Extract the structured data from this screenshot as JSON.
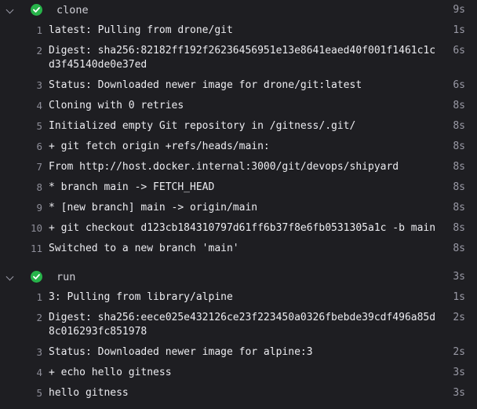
{
  "colors": {
    "background": "#1e1e22",
    "success": "#27b34a",
    "text": "#ececf0",
    "muted": "#9a9aa6"
  },
  "steps": [
    {
      "name": "clone",
      "duration": "9s",
      "status_icon": "success-check-icon",
      "lines": [
        {
          "num": "1",
          "text": "latest: Pulling from drone/git",
          "time": "1s"
        },
        {
          "num": "2",
          "text": "Digest: sha256:82182ff192f26236456951e13e8641eaed40f001f1461c1cd3f45140de0e37ed",
          "time": "6s"
        },
        {
          "num": "3",
          "text": "Status: Downloaded newer image for drone/git:latest",
          "time": "6s"
        },
        {
          "num": "4",
          "text": "Cloning with 0 retries",
          "time": "8s"
        },
        {
          "num": "5",
          "text": "Initialized empty Git repository in /gitness/.git/",
          "time": "8s"
        },
        {
          "num": "6",
          "text": "+ git fetch origin +refs/heads/main:",
          "time": "8s"
        },
        {
          "num": "7",
          "text": "From http://host.docker.internal:3000/git/devops/shipyard",
          "time": "8s"
        },
        {
          "num": "8",
          "text": "* branch main -> FETCH_HEAD",
          "time": "8s"
        },
        {
          "num": "9",
          "text": "* [new branch] main -> origin/main",
          "time": "8s"
        },
        {
          "num": "10",
          "text": "+ git checkout d123cb184310797d61ff6b37f8e6fb0531305a1c -b main",
          "time": "8s"
        },
        {
          "num": "11",
          "text": "Switched to a new branch 'main'",
          "time": "8s"
        }
      ]
    },
    {
      "name": "run",
      "duration": "3s",
      "status_icon": "success-check-icon",
      "lines": [
        {
          "num": "1",
          "text": "3: Pulling from library/alpine",
          "time": "1s"
        },
        {
          "num": "2",
          "text": "Digest: sha256:eece025e432126ce23f223450a0326fbebde39cdf496a85d8c016293fc851978",
          "time": "2s"
        },
        {
          "num": "3",
          "text": "Status: Downloaded newer image for alpine:3",
          "time": "2s"
        },
        {
          "num": "4",
          "text": "+ echo hello gitness",
          "time": "3s"
        },
        {
          "num": "5",
          "text": "hello gitness",
          "time": "3s"
        }
      ]
    }
  ]
}
